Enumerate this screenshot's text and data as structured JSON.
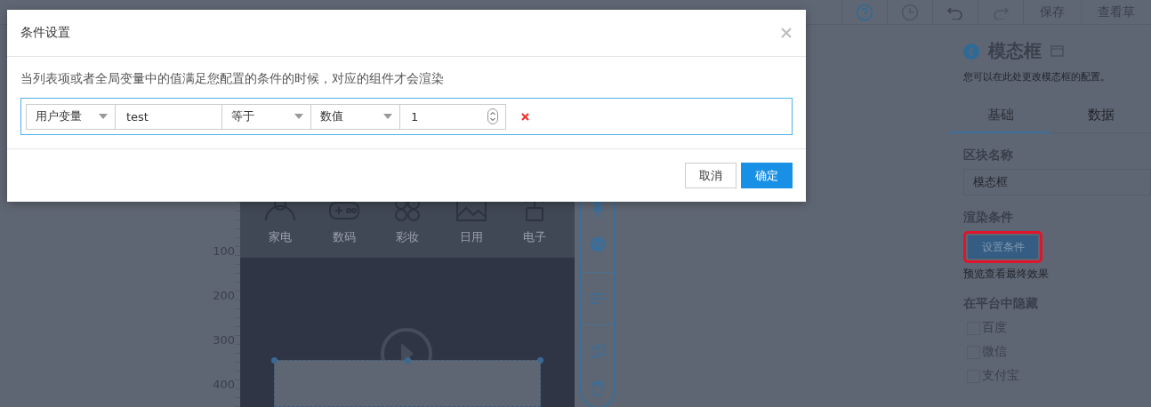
{
  "toolbar": {
    "actions": [
      "保存",
      "查看草"
    ]
  },
  "ruler": {
    "labels": [
      "100",
      "200",
      "300",
      "400"
    ]
  },
  "canvas": {
    "categories": [
      {
        "label": "家电"
      },
      {
        "label": "数码"
      },
      {
        "label": "彩妆"
      },
      {
        "label": "日用"
      },
      {
        "label": "电子"
      }
    ]
  },
  "panel": {
    "title": "模态框",
    "description": "您可以在此处更改模态框的配置。",
    "tabs": [
      {
        "label": "基础",
        "selected": true
      },
      {
        "label": "数据",
        "selected": false
      }
    ],
    "block_name": {
      "label": "区块名称",
      "value": "模态框"
    },
    "render_condition": {
      "label": "渲染条件",
      "button": "设置条件",
      "highlighted": true,
      "hint": "预览查看最终效果"
    },
    "hide_on_platform": {
      "label": "在平台中隐藏",
      "options": [
        {
          "label": "百度",
          "checked": false
        },
        {
          "label": "微信",
          "checked": false
        },
        {
          "label": "支付宝",
          "checked": false
        }
      ]
    }
  },
  "dialog": {
    "title": "条件设置",
    "description": "当列表项或者全局变量中的值满足您配置的条件的时候，对应的组件才会渲染",
    "condition": {
      "source": "用户变量",
      "variable": "test",
      "operator": "等于",
      "value_type": "数值",
      "value": "1"
    },
    "buttons": {
      "cancel": "取消",
      "confirm": "确定"
    }
  }
}
